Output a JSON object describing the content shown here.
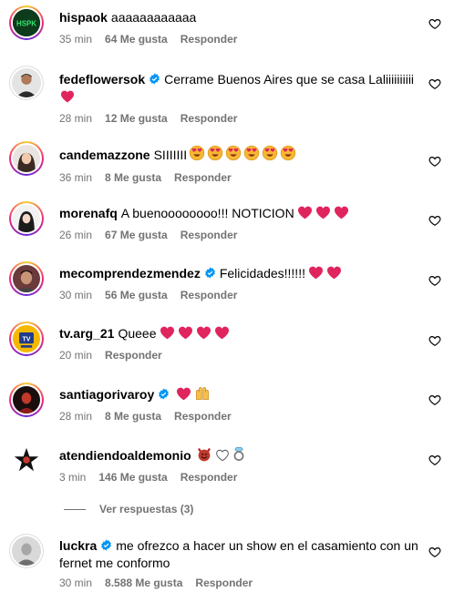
{
  "comments": [
    {
      "username": "hispaok",
      "verified": false,
      "text": "aaaaaaaaaaaa",
      "time": "35 min",
      "likes": "64 Me gusta",
      "reply": "Responder"
    },
    {
      "username": "fedeflowersok",
      "verified": true,
      "text": "Cerrame Buenos Aires que se casa Laliiiiiiiiii",
      "time": "28 min",
      "likes": "12 Me gusta",
      "reply": "Responder"
    },
    {
      "username": "candemazzone",
      "verified": false,
      "text": "SIIIIIII",
      "time": "36 min",
      "likes": "8 Me gusta",
      "reply": "Responder"
    },
    {
      "username": "morenafq",
      "verified": false,
      "text": "A buenoooooooo!!! NOTICION",
      "time": "26 min",
      "likes": "67 Me gusta",
      "reply": "Responder"
    },
    {
      "username": "mecomprendezmendez",
      "verified": true,
      "text": "Felicidades!!!!!!",
      "time": "30 min",
      "likes": "56 Me gusta",
      "reply": "Responder"
    },
    {
      "username": "tv.arg_21",
      "verified": false,
      "text": "Queee",
      "time": "20 min",
      "likes": "",
      "reply": "Responder"
    },
    {
      "username": "santiagorivaroy",
      "verified": true,
      "text": "",
      "time": "28 min",
      "likes": "8 Me gusta",
      "reply": "Responder"
    },
    {
      "username": "atendiendoaldemonio",
      "verified": false,
      "text": "",
      "time": "3 min",
      "likes": "146 Me gusta",
      "reply": "Responder"
    },
    {
      "username": "luckra",
      "verified": true,
      "text": "me ofrezco a hacer un show en el casamiento con un fernet me conformo",
      "time": "30 min",
      "likes": "8.588 Me gusta",
      "reply": "Responder"
    }
  ],
  "view_replies": "Ver respuestas (3)",
  "avatar_texts": {
    "hispaok": "HSPK",
    "tvarg": "TV"
  },
  "colors": {
    "meta": "#737373",
    "verified": "#0095f6",
    "heart_red": "#e0245e"
  },
  "icons": {
    "like": "heart-outline-icon",
    "verified": "verified-badge-icon"
  }
}
